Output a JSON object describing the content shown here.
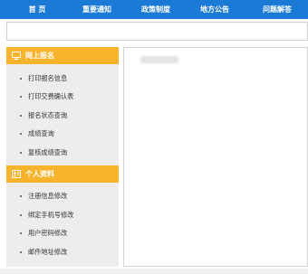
{
  "topnav": {
    "items": [
      {
        "label": "首  页"
      },
      {
        "label": "重要通知"
      },
      {
        "label": "政策制度"
      },
      {
        "label": "地方公告"
      },
      {
        "label": "问题解答"
      }
    ]
  },
  "search": {
    "value": ""
  },
  "sidebar": {
    "sections": [
      {
        "title": "网上报名",
        "icon": "monitor-icon",
        "items": [
          {
            "label": "打印报名信息"
          },
          {
            "label": "打印交费确认表"
          },
          {
            "label": "报名状态查询"
          },
          {
            "label": "成绩查询"
          },
          {
            "label": "复核成绩查询"
          }
        ]
      },
      {
        "title": "个人资料",
        "icon": "id-card-icon",
        "items": [
          {
            "label": "注册信息修改"
          },
          {
            "label": "绑定手机号修改"
          },
          {
            "label": "用户密码修改"
          },
          {
            "label": "邮件地址修改"
          }
        ]
      }
    ]
  },
  "colors": {
    "nav_bg": "#1a7ad6",
    "section_header_bg": "#f7b32b",
    "sidebar_bg": "#ededed"
  }
}
